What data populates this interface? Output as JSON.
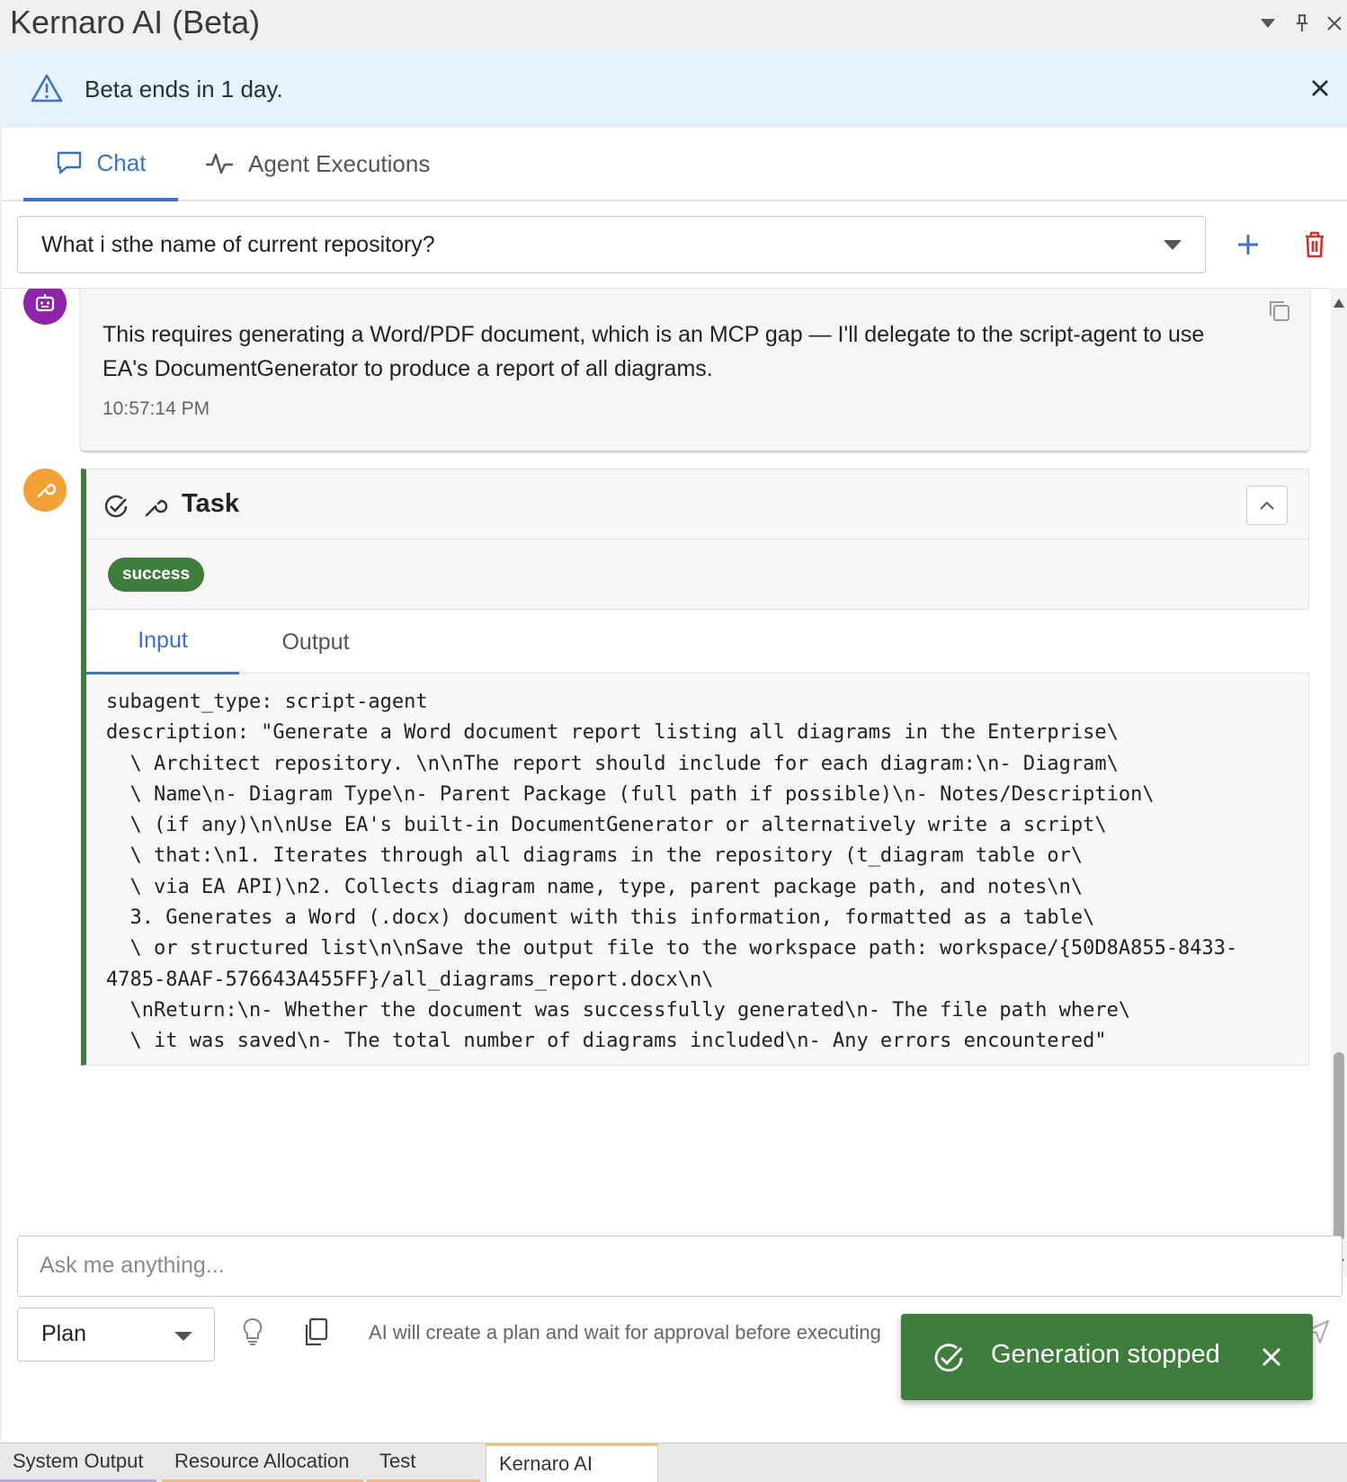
{
  "window": {
    "title": "Kernaro AI (Beta)",
    "controls": [
      "dropdown-icon",
      "pin-icon",
      "close-icon"
    ]
  },
  "banner": {
    "icon": "warning-icon",
    "message": "Beta ends in 1 day.",
    "close_icon": "close-icon"
  },
  "tabs": [
    {
      "label": "Chat",
      "icon": "chat-icon",
      "active": true
    },
    {
      "label": "Agent Executions",
      "icon": "activity-icon",
      "active": false
    }
  ],
  "session": {
    "selected": "What i sthe name of current repository?",
    "new_icon": "plus-icon",
    "delete_icon": "trash-icon"
  },
  "messages": [
    {
      "role": "assistant",
      "avatar_icon": "robot-icon",
      "text": "This requires generating a Word/PDF document, which is an MCP gap — I'll delegate to the script-agent to use EA's DocumentGenerator to produce a report of all diagrams.",
      "time": "10:57:14 PM",
      "copy_icon": "copy-icon"
    }
  ],
  "task": {
    "avatar_icon": "wrench-icon",
    "title": "Task",
    "status": "success",
    "tabs": [
      "Input",
      "Output"
    ],
    "active_tab": "Input",
    "input": "subagent_type: script-agent\ndescription: \"Generate a Word document report listing all diagrams in the Enterprise\\\n  \\ Architect repository. \\n\\nThe report should include for each diagram:\\n- Diagram\\\n  \\ Name\\n- Diagram Type\\n- Parent Package (full path if possible)\\n- Notes/Description\\\n  \\ (if any)\\n\\nUse EA's built-in DocumentGenerator or alternatively write a script\\\n  \\ that:\\n1. Iterates through all diagrams in the repository (t_diagram table or\\\n  \\ via EA API)\\n2. Collects diagram name, type, parent package path, and notes\\n\\\n  3. Generates a Word (.docx) document with this information, formatted as a table\\\n  \\ or structured list\\n\\nSave the output file to the workspace path: workspace/{50D8A855-8433-\n4785-8AAF-576643A455FF}/all_diagrams_report.docx\\n\\\n  \\nReturn:\\n- Whether the document was successfully generated\\n- The file path where\\\n  \\ it was saved\\n- The total number of diagrams included\\n- Any errors encountered\""
  },
  "composer": {
    "placeholder": "Ask me anything...",
    "mode": "Plan",
    "hint": "AI will create a plan and wait for approval before executing"
  },
  "toast": {
    "message": "Generation stopped"
  },
  "bottom_tabs": [
    {
      "label": "System Output",
      "color": "#b9a6e6"
    },
    {
      "label": "Resource Allocation",
      "color": "#f2b98a"
    },
    {
      "label": "Test Cases",
      "color": "#f2b98a"
    },
    {
      "label": "Kernaro AI (Beta)",
      "color": "#e8c76a",
      "active": true
    }
  ],
  "colors": {
    "accent": "#3b72c4",
    "success": "#3f7d3c",
    "banner_bg": "#e7f3fc",
    "danger": "#d0342c",
    "bot_avatar": "#8e24aa",
    "tool_avatar": "#f2a236"
  }
}
